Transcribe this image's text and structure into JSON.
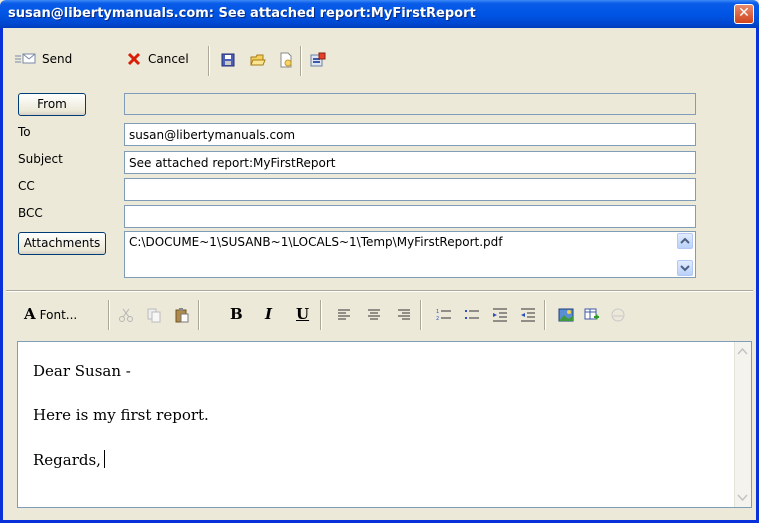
{
  "window": {
    "title": "susan@libertymanuals.com: See attached report:MyFirstReport",
    "close_glyph": "✕"
  },
  "toolbar": {
    "send_label": "Send",
    "cancel_label": "Cancel"
  },
  "form": {
    "from_button": "From",
    "from_value": "",
    "to_label": "To",
    "to_value": "susan@libertymanuals.com",
    "subject_label": "Subject",
    "subject_value": "See attached report:MyFirstReport",
    "cc_label": "CC",
    "cc_value": "",
    "bcc_label": "BCC",
    "bcc_value": "",
    "attachments_button": "Attachments",
    "attachments_value": "C:\\DOCUME~1\\SUSANB~1\\LOCALS~1\\Temp\\MyFirstReport.pdf"
  },
  "format_toolbar": {
    "font_label": "Font...",
    "font_glyph": "A",
    "bold": "B",
    "italic": "I",
    "underline": "U"
  },
  "body": {
    "line1": "Dear Susan -",
    "line2": "Here is my first report.",
    "line3": "Regards,"
  },
  "colors": {
    "titlebar": "#0055e5",
    "close_button": "#d0431c",
    "frame": "#ece9d8",
    "input_border": "#7f9db9"
  }
}
